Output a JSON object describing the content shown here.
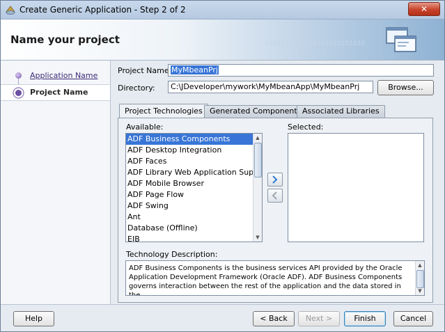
{
  "window": {
    "title": "Create Generic Application - Step 2 of 2",
    "close_label": "✕"
  },
  "header": {
    "title": "Name your project",
    "binary_text": "0101010101010101010101010"
  },
  "sidebar": {
    "items": [
      {
        "label": "Application Name"
      },
      {
        "label": "Project Name"
      }
    ]
  },
  "form": {
    "project_name_label": "Project Name:",
    "project_name_value": "MyMbeanPrj",
    "directory_label": "Directory:",
    "directory_value": "C:\\JDeveloper\\mywork\\MyMbeanApp\\MyMbeanPrj",
    "browse_label": "Browse..."
  },
  "tabs": [
    {
      "label": "Project Technologies"
    },
    {
      "label": "Generated Components"
    },
    {
      "label": "Associated Libraries"
    }
  ],
  "available": {
    "label": "Available:",
    "items": [
      "ADF Business Components",
      "ADF Desktop Integration",
      "ADF Faces",
      "ADF Library Web Application Support",
      "ADF Mobile Browser",
      "ADF Page Flow",
      "ADF Swing",
      "Ant",
      "Database (Offline)",
      "EJB"
    ],
    "selected_index": 0
  },
  "selected": {
    "label": "Selected:"
  },
  "description": {
    "label": "Technology Description:",
    "text": "ADF Business Components is the business services API provided by the Oracle Application Development Framework (Oracle ADF).  ADF Business Components governs interaction between the rest of the application and the data stored in the"
  },
  "footer": {
    "help": "Help",
    "back": "< Back",
    "next": "Next >",
    "finish": "Finish",
    "cancel": "Cancel"
  }
}
